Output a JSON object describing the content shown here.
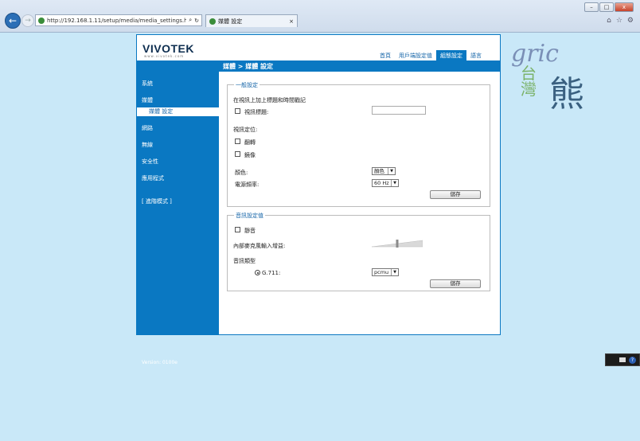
{
  "browser": {
    "url": "http://192.168.1.11/setup/media/media_settings.htr",
    "tab_title": "媒體 設定",
    "win_minimize": "–",
    "win_maximize": "□",
    "win_close": "x",
    "search_icon": "⌕",
    "refresh_icon": "↻",
    "tab_close": "×"
  },
  "header": {
    "logo": "VIVOTEK",
    "logo_sub": "www.vivotek.com",
    "breadcrumb": "媒體 > 媒體 設定",
    "nav": [
      "首頁",
      "用戶端設定值",
      "組態設定",
      "語言"
    ]
  },
  "sidebar": {
    "items": [
      "系統",
      "媒體",
      "網路",
      "無線",
      "安全性",
      "應用程式",
      "[ 進階模式 ]"
    ],
    "sub_item": "媒體 設定",
    "version": "Version: 0100e"
  },
  "general": {
    "legend": "一般設定",
    "overlay_title": "在視訊上加上標題和時間戳記",
    "video_title_label": "視訊標題:",
    "orientation_label": "視訊定位:",
    "flip_label": "翻轉",
    "mirror_label": "鏡像",
    "color_label": "顏色:",
    "color_value": "顏色",
    "power_freq_label": "電源頻率:",
    "power_freq_value": "60 Hz",
    "save_label": "儲存"
  },
  "audio": {
    "legend": "音訊設定值",
    "mute_label": "靜音",
    "mic_gain_label": "內部麥克風輸入增益:",
    "mic_gain_level": 0.5,
    "audio_type_label": "音訊類型",
    "codec_label": "G.711:",
    "codec_value": "pcmu",
    "save_label": "儲存"
  },
  "watermark": {
    "line1": "gric",
    "line2a": "台",
    "line2b": "灣",
    "line3": "熊"
  },
  "tray": {
    "help_icon": "?"
  }
}
